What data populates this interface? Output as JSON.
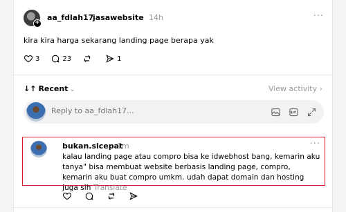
{
  "post": {
    "username": "aa_fdlah17",
    "separator": "›",
    "community": "jasawebsite",
    "time": "14h",
    "more_label": "···",
    "text": "kira kira harga sekarang landing page berapa yak",
    "likes": "3",
    "comments": "23",
    "shares": "1"
  },
  "sort": {
    "label": "Recent",
    "view_activity": "View activity ›"
  },
  "reply": {
    "placeholder": "Reply to aa_fdlah17..."
  },
  "comment": {
    "username": "bukan.sicepat",
    "time": "1m",
    "more_label": "···",
    "text": "kalau landing page atau compro bisa ke idwebhost bang, kemarin aku tanya\" bisa membuat website berbasis landing page, compro, kemarin aku buat compro umkm. udah dapat domain dan hosting juga sih",
    "translate_label": "Translate"
  },
  "colors": {
    "highlight_border": "#e0162b",
    "muted": "#999999"
  }
}
